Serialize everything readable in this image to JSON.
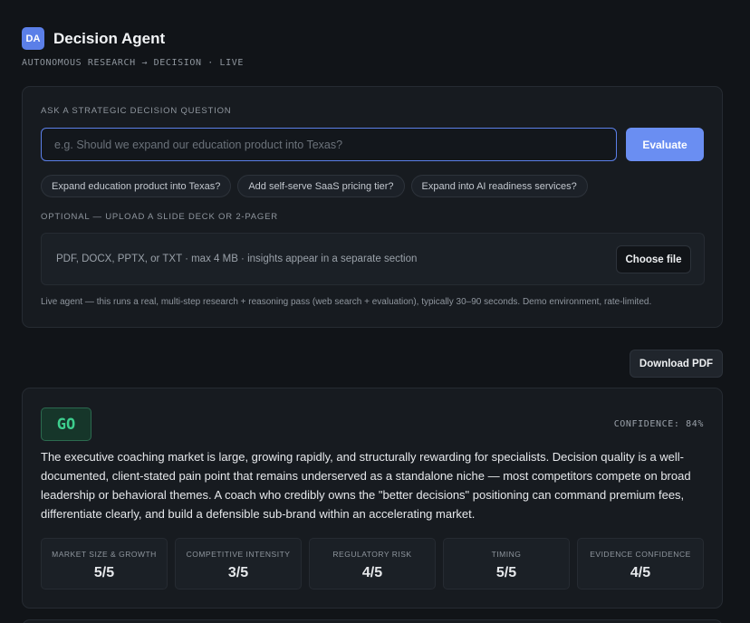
{
  "app": {
    "logo_text": "DA",
    "title": "Decision Agent",
    "subtitle": "AUTONOMOUS RESEARCH → DECISION · LIVE"
  },
  "ask": {
    "label": "ASK A STRATEGIC DECISION QUESTION",
    "input_value": "",
    "input_placeholder": "e.g. Should we expand our education product into Texas?",
    "evaluate_label": "Evaluate",
    "suggestions": [
      "Expand education product into Texas?",
      "Add self-serve SaaS pricing tier?",
      "Expand into AI readiness services?"
    ],
    "upload_label": "OPTIONAL — UPLOAD A SLIDE DECK OR 2-PAGER",
    "upload_hint": "PDF, DOCX, PPTX, or TXT · max 4 MB · insights appear in a separate section",
    "choose_file_label": "Choose file",
    "live_note": "Live agent — this runs a real, multi-step research + reasoning pass (web search + evaluation), typically 30–90 seconds. Demo environment, rate-limited."
  },
  "toolbar": {
    "download_label": "Download PDF"
  },
  "result": {
    "verdict": "GO",
    "confidence_text": "CONFIDENCE: 84%",
    "summary": "The executive coaching market is large, growing rapidly, and structurally rewarding for specialists. Decision quality is a well-documented, client-stated pain point that remains underserved as a standalone niche — most competitors compete on broad leadership or behavioral themes. A coach who credibly owns the \"better decisions\" positioning can command premium fees, differentiate clearly, and build a defensible sub-brand within an accelerating market.",
    "scores": [
      {
        "label": "MARKET SIZE & GROWTH",
        "value": "5/5"
      },
      {
        "label": "COMPETITIVE INTENSITY",
        "value": "3/5"
      },
      {
        "label": "REGULATORY RISK",
        "value": "4/5"
      },
      {
        "label": "TIMING",
        "value": "5/5"
      },
      {
        "label": "EVIDENCE CONFIDENCE",
        "value": "4/5"
      }
    ]
  },
  "colors": {
    "background": "#111418",
    "accent": "#6a8ef2",
    "go_green": "#3dcf8e"
  }
}
